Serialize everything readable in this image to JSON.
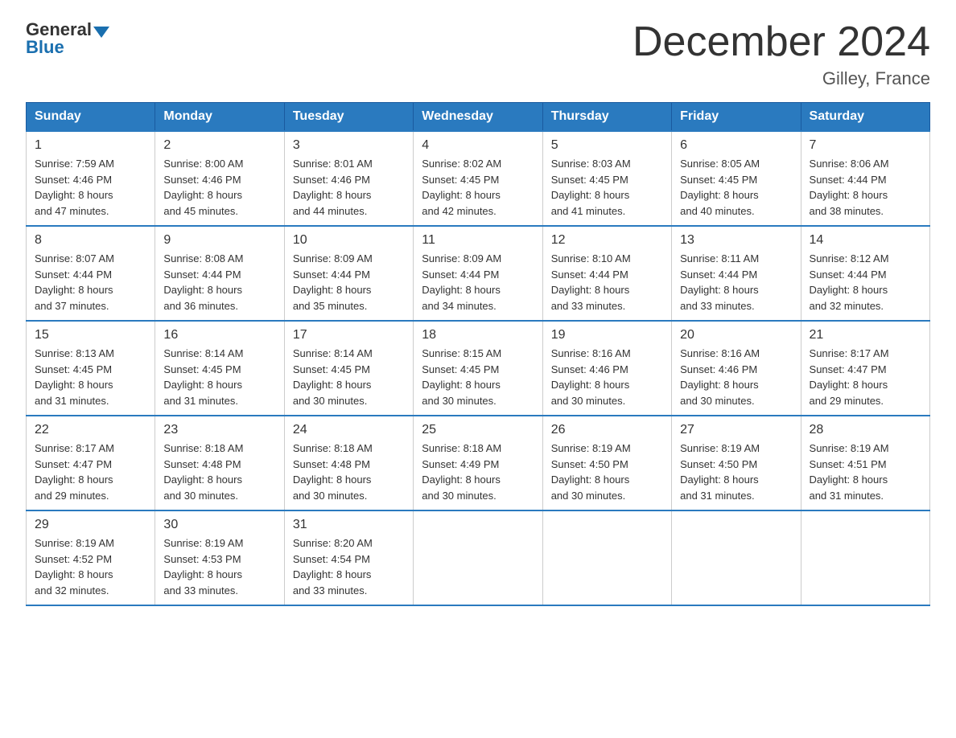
{
  "header": {
    "logo_general": "General",
    "logo_blue": "Blue",
    "title": "December 2024",
    "subtitle": "Gilley, France"
  },
  "weekdays": [
    "Sunday",
    "Monday",
    "Tuesday",
    "Wednesday",
    "Thursday",
    "Friday",
    "Saturday"
  ],
  "weeks": [
    [
      {
        "day": "1",
        "sunrise": "7:59 AM",
        "sunset": "4:46 PM",
        "daylight": "8 hours and 47 minutes."
      },
      {
        "day": "2",
        "sunrise": "8:00 AM",
        "sunset": "4:46 PM",
        "daylight": "8 hours and 45 minutes."
      },
      {
        "day": "3",
        "sunrise": "8:01 AM",
        "sunset": "4:46 PM",
        "daylight": "8 hours and 44 minutes."
      },
      {
        "day": "4",
        "sunrise": "8:02 AM",
        "sunset": "4:45 PM",
        "daylight": "8 hours and 42 minutes."
      },
      {
        "day": "5",
        "sunrise": "8:03 AM",
        "sunset": "4:45 PM",
        "daylight": "8 hours and 41 minutes."
      },
      {
        "day": "6",
        "sunrise": "8:05 AM",
        "sunset": "4:45 PM",
        "daylight": "8 hours and 40 minutes."
      },
      {
        "day": "7",
        "sunrise": "8:06 AM",
        "sunset": "4:44 PM",
        "daylight": "8 hours and 38 minutes."
      }
    ],
    [
      {
        "day": "8",
        "sunrise": "8:07 AM",
        "sunset": "4:44 PM",
        "daylight": "8 hours and 37 minutes."
      },
      {
        "day": "9",
        "sunrise": "8:08 AM",
        "sunset": "4:44 PM",
        "daylight": "8 hours and 36 minutes."
      },
      {
        "day": "10",
        "sunrise": "8:09 AM",
        "sunset": "4:44 PM",
        "daylight": "8 hours and 35 minutes."
      },
      {
        "day": "11",
        "sunrise": "8:09 AM",
        "sunset": "4:44 PM",
        "daylight": "8 hours and 34 minutes."
      },
      {
        "day": "12",
        "sunrise": "8:10 AM",
        "sunset": "4:44 PM",
        "daylight": "8 hours and 33 minutes."
      },
      {
        "day": "13",
        "sunrise": "8:11 AM",
        "sunset": "4:44 PM",
        "daylight": "8 hours and 33 minutes."
      },
      {
        "day": "14",
        "sunrise": "8:12 AM",
        "sunset": "4:44 PM",
        "daylight": "8 hours and 32 minutes."
      }
    ],
    [
      {
        "day": "15",
        "sunrise": "8:13 AM",
        "sunset": "4:45 PM",
        "daylight": "8 hours and 31 minutes."
      },
      {
        "day": "16",
        "sunrise": "8:14 AM",
        "sunset": "4:45 PM",
        "daylight": "8 hours and 31 minutes."
      },
      {
        "day": "17",
        "sunrise": "8:14 AM",
        "sunset": "4:45 PM",
        "daylight": "8 hours and 30 minutes."
      },
      {
        "day": "18",
        "sunrise": "8:15 AM",
        "sunset": "4:45 PM",
        "daylight": "8 hours and 30 minutes."
      },
      {
        "day": "19",
        "sunrise": "8:16 AM",
        "sunset": "4:46 PM",
        "daylight": "8 hours and 30 minutes."
      },
      {
        "day": "20",
        "sunrise": "8:16 AM",
        "sunset": "4:46 PM",
        "daylight": "8 hours and 30 minutes."
      },
      {
        "day": "21",
        "sunrise": "8:17 AM",
        "sunset": "4:47 PM",
        "daylight": "8 hours and 29 minutes."
      }
    ],
    [
      {
        "day": "22",
        "sunrise": "8:17 AM",
        "sunset": "4:47 PM",
        "daylight": "8 hours and 29 minutes."
      },
      {
        "day": "23",
        "sunrise": "8:18 AM",
        "sunset": "4:48 PM",
        "daylight": "8 hours and 30 minutes."
      },
      {
        "day": "24",
        "sunrise": "8:18 AM",
        "sunset": "4:48 PM",
        "daylight": "8 hours and 30 minutes."
      },
      {
        "day": "25",
        "sunrise": "8:18 AM",
        "sunset": "4:49 PM",
        "daylight": "8 hours and 30 minutes."
      },
      {
        "day": "26",
        "sunrise": "8:19 AM",
        "sunset": "4:50 PM",
        "daylight": "8 hours and 30 minutes."
      },
      {
        "day": "27",
        "sunrise": "8:19 AM",
        "sunset": "4:50 PM",
        "daylight": "8 hours and 31 minutes."
      },
      {
        "day": "28",
        "sunrise": "8:19 AM",
        "sunset": "4:51 PM",
        "daylight": "8 hours and 31 minutes."
      }
    ],
    [
      {
        "day": "29",
        "sunrise": "8:19 AM",
        "sunset": "4:52 PM",
        "daylight": "8 hours and 32 minutes."
      },
      {
        "day": "30",
        "sunrise": "8:19 AM",
        "sunset": "4:53 PM",
        "daylight": "8 hours and 33 minutes."
      },
      {
        "day": "31",
        "sunrise": "8:20 AM",
        "sunset": "4:54 PM",
        "daylight": "8 hours and 33 minutes."
      },
      null,
      null,
      null,
      null
    ]
  ],
  "labels": {
    "sunrise": "Sunrise:",
    "sunset": "Sunset:",
    "daylight": "Daylight:"
  }
}
